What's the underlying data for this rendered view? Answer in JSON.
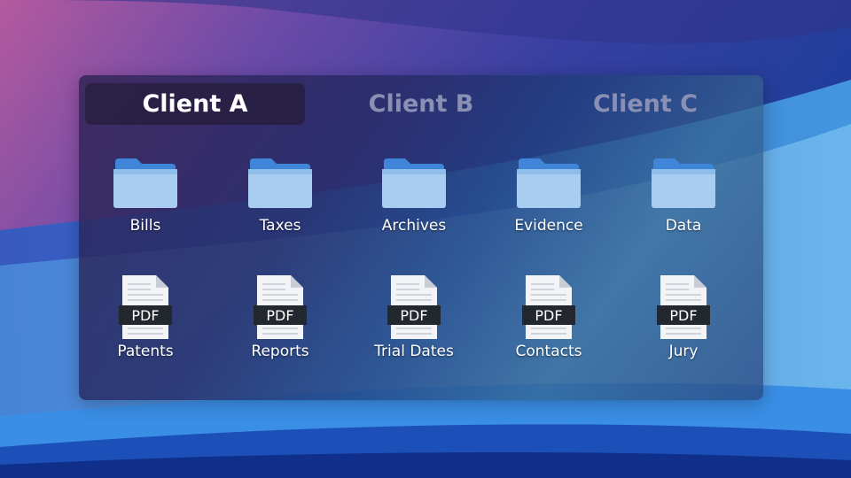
{
  "tabs": [
    {
      "label": "Client A",
      "active": true
    },
    {
      "label": "Client B",
      "active": false
    },
    {
      "label": "Client C",
      "active": false
    }
  ],
  "folders": [
    {
      "label": "Bills",
      "icon": "folder-icon"
    },
    {
      "label": "Taxes",
      "icon": "folder-icon"
    },
    {
      "label": "Archives",
      "icon": "folder-icon"
    },
    {
      "label": "Evidence",
      "icon": "folder-icon"
    },
    {
      "label": "Data",
      "icon": "folder-icon"
    }
  ],
  "files": [
    {
      "label": "Patents",
      "badge": "PDF",
      "icon": "pdf-file-icon"
    },
    {
      "label": "Reports",
      "badge": "PDF",
      "icon": "pdf-file-icon"
    },
    {
      "label": "Trial Dates",
      "badge": "PDF",
      "icon": "pdf-file-icon"
    },
    {
      "label": "Contacts",
      "badge": "PDF",
      "icon": "pdf-file-icon"
    },
    {
      "label": "Jury",
      "badge": "PDF",
      "icon": "pdf-file-icon"
    }
  ],
  "colors": {
    "folder_tab": "#3f86d8",
    "folder_body": "#a9cdf0",
    "pdf_badge": "#23272e",
    "active_tab_bg": "#281e40"
  }
}
